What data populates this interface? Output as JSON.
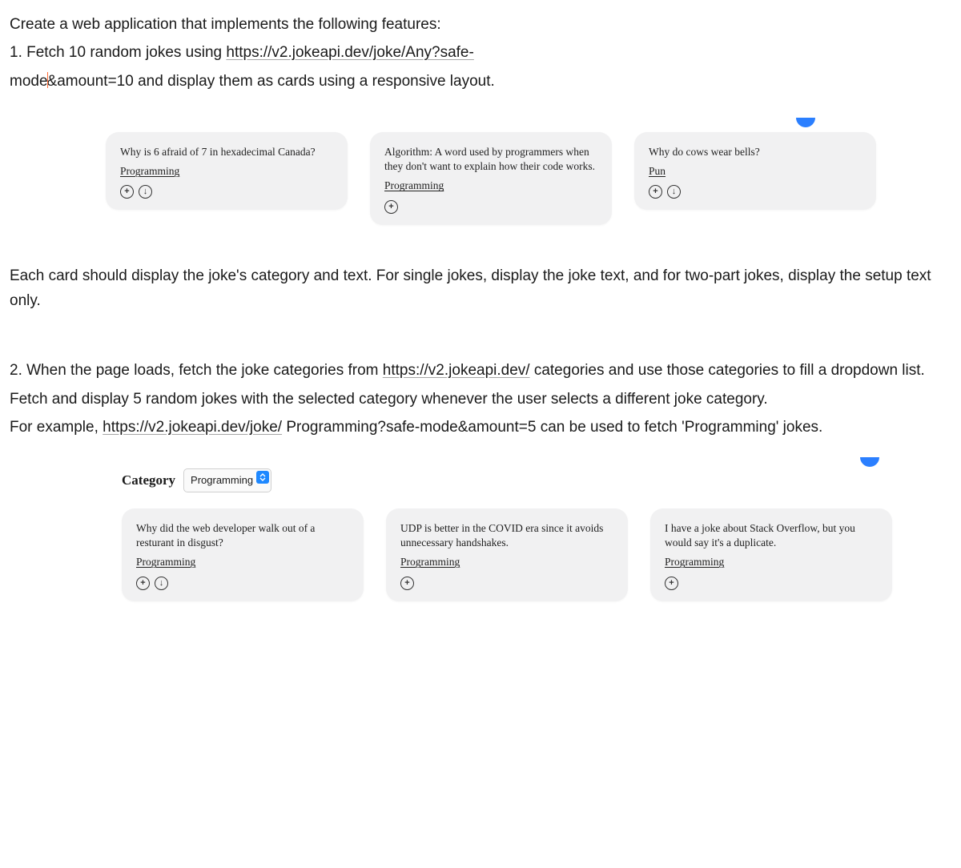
{
  "intro": {
    "line1": "Create a web application that implements the following features:",
    "line2_pre": "1. Fetch 10 random jokes using ",
    "line2_link": "https://v2.jokeapi.dev/joke/Any?safe-",
    "line3_pre": "mode",
    "line3_post": "&amount=10 and display them as cards using a responsive layout."
  },
  "cards1": [
    {
      "text": "Why is 6 afraid of 7 in hexadecimal Canada?",
      "category": "Programming",
      "icons": [
        "plus",
        "down"
      ]
    },
    {
      "text": "Algorithm: A word used by programmers when they don't want to explain how their code works.",
      "category": "Programming",
      "icons": [
        "plus"
      ]
    },
    {
      "text": "Why do cows wear bells?",
      "category": "Pun",
      "icons": [
        "plus",
        "down"
      ]
    }
  ],
  "midpara1": "Each card should display the joke's category and text. For single jokes, display the joke text, and for two-part jokes, display the setup text only.",
  "section2": {
    "p1_pre": "2. When the page loads, fetch the joke categories from ",
    "p1_link": "https://v2.jokeapi.dev/",
    "p1_post": " categories and use those categories to fill a dropdown list.",
    "p2": "Fetch and display 5 random jokes with the selected category whenever the user selects a different joke category.",
    "p3_pre": "For example, ",
    "p3_link": "https://v2.jokeapi.dev/joke/",
    "p3_post": " Programming?safe-mode&amount=5 can be used to fetch 'Programming' jokes."
  },
  "categoryLabel": "Category",
  "categorySelected": "Programming",
  "cards2": [
    {
      "text": "Why did the web developer walk out of a resturant in disgust?",
      "category": "Programming",
      "icons": [
        "plus",
        "down"
      ]
    },
    {
      "text": "UDP is better in the COVID era since it avoids unnecessary handshakes.",
      "category": "Programming",
      "icons": [
        "plus"
      ]
    },
    {
      "text": "I have a joke about Stack Overflow, but you would say it's a duplicate.",
      "category": "Programming",
      "icons": [
        "plus"
      ]
    }
  ]
}
